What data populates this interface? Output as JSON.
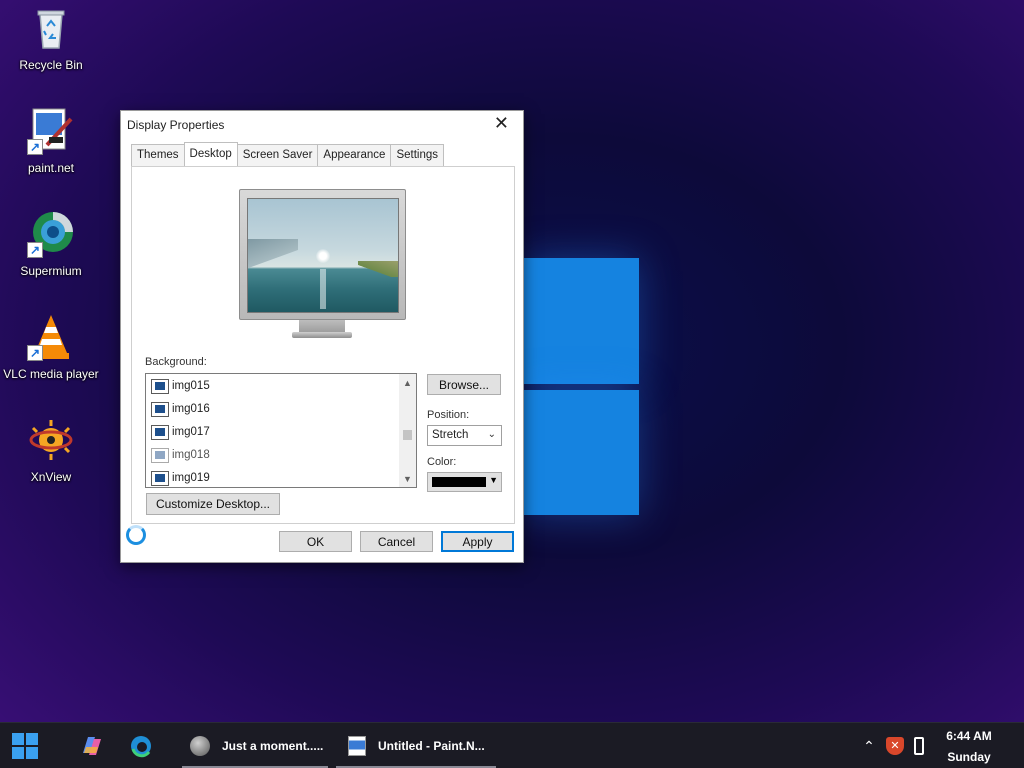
{
  "desktop": {
    "icons": [
      {
        "label": "Recycle Bin",
        "icon": "recycle-bin-icon"
      },
      {
        "label": "paint.net",
        "icon": "paintnet-icon"
      },
      {
        "label": "Supermium",
        "icon": "supermium-icon"
      },
      {
        "label": "VLC media player",
        "icon": "vlc-icon"
      },
      {
        "label": "XnView",
        "icon": "xnview-icon"
      }
    ]
  },
  "dialog": {
    "title": "Display Properties",
    "close_glyph": "✕",
    "tabs": [
      "Themes",
      "Desktop",
      "Screen Saver",
      "Appearance",
      "Settings"
    ],
    "active_tab": "Desktop",
    "background_label": "Background:",
    "background_items": [
      "img015",
      "img016",
      "img017",
      "img018",
      "img019"
    ],
    "selected_item": "img018",
    "browse_label": "Browse...",
    "position_label": "Position:",
    "position_value": "Stretch",
    "color_label": "Color:",
    "color_value": "#000000",
    "customize_label": "Customize Desktop...",
    "ok_label": "OK",
    "cancel_label": "Cancel",
    "apply_label": "Apply"
  },
  "taskbar": {
    "tasks": [
      {
        "label": "Just a moment.....",
        "icon": "browser-icon"
      },
      {
        "label": "Untitled - Paint.N...",
        "icon": "paintnet-icon"
      }
    ],
    "time": "6:44 AM",
    "day": "Sunday"
  },
  "colors": {
    "accent": "#0078d7",
    "windows_logo": "#1583e0",
    "taskbar": "#1b1b24"
  }
}
